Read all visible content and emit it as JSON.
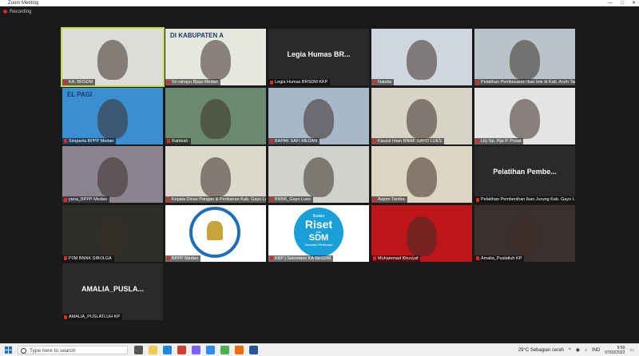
{
  "window": {
    "title": "Zoom Meeting",
    "controls": [
      "—",
      "□",
      "✕"
    ]
  },
  "recording": {
    "label": "Recording"
  },
  "participants": [
    {
      "name": "KA. BRSDM",
      "type": "video",
      "bg": "#dcdcd8",
      "active": true
    },
    {
      "name": "Sri rahayu Bppp Medan",
      "type": "video",
      "bg": "#e6e8e0",
      "overlay": "DI KABUPATEN A"
    },
    {
      "name": "Legia Humas BRSDM KKP",
      "type": "name",
      "display": "Legia Humas BR..."
    },
    {
      "name": "Natalia",
      "type": "video",
      "bg": "#cfd6de"
    },
    {
      "name": "Pelatihan Pembesaran Ikan lele di Kab. Aceh Tamiang",
      "type": "video",
      "bg": "#b8c4c9"
    },
    {
      "name": "Simparta BPPP Medan",
      "type": "video",
      "bg": "#3a8fd0",
      "overlay": "EL PAGI"
    },
    {
      "name": "Rahbiah",
      "type": "video",
      "bg": "#6b8a6d"
    },
    {
      "name": "BAPAK SAFI MEDAN",
      "type": "video",
      "bg": "#a7b8c8"
    },
    {
      "name": "Fauzul Iman BNNK GAYO LUES",
      "type": "video",
      "bg": "#d7d3c7"
    },
    {
      "name": "Lily Sp. Pija P. Pusat",
      "type": "video",
      "bg": "#e4e4e4"
    },
    {
      "name": "yana_BPPP Medan",
      "type": "video",
      "bg": "#8a8490"
    },
    {
      "name": "Kepala Dinas Pangan & Perikanan Kab. Gayo Lues",
      "type": "video",
      "bg": "#dcd8cc"
    },
    {
      "name": "BNNK_Gayo Lues",
      "type": "video",
      "bg": "#cfd3cc"
    },
    {
      "name": "Asprin Tamba",
      "type": "video",
      "bg": "#ded6c2"
    },
    {
      "name": "Pelatihan Pembenihan Ikan Jurung Kab. Gayo Lues",
      "type": "name",
      "display": "Pelatihan Pembe..."
    },
    {
      "name": "P2M BNNK SIBOLGA",
      "type": "video",
      "bg": "#2b2f28"
    },
    {
      "name": "BPPP Medan",
      "type": "logo",
      "bg": "#ffffff"
    },
    {
      "name": "KKP | Sekretaris KA BRSDM",
      "type": "logo2",
      "bg": "#ffffff",
      "logo_title": "Riset",
      "logo_top": "Badan",
      "logo_sub": "SDM",
      "logo_small": "dan",
      "logo_foot": "Kelautan Perikanan"
    },
    {
      "name": "Muhammad Khusyaf",
      "type": "video",
      "bg": "#c0151a"
    },
    {
      "name": "Amalia_Puslatluh KP",
      "type": "video",
      "bg": "#3b3030"
    },
    {
      "name": "AMALIA_PUSLATLUH KP",
      "type": "name",
      "display": "AMALIA_PUSLA..."
    }
  ],
  "taskbar": {
    "search_placeholder": "Type here to search",
    "weather": "29°C  Sebagian cerah",
    "lang": "IND",
    "time": "9:59",
    "date": "07/03/2022"
  },
  "colors": {
    "active_outline": "#c6d93a",
    "mic_muted": "#e02828",
    "background": "#1a1a1a"
  }
}
